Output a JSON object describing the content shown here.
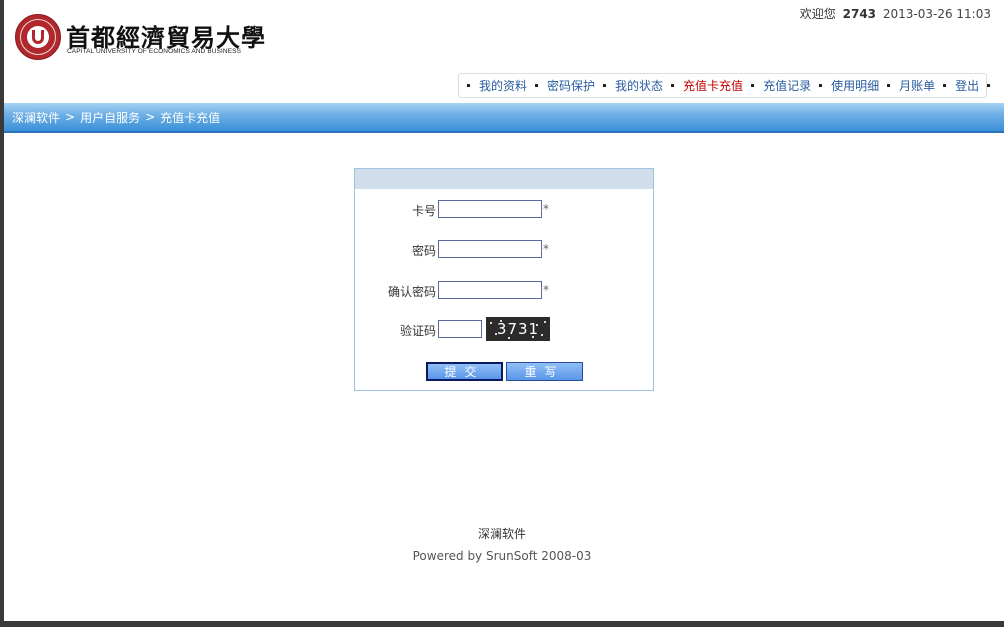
{
  "header": {
    "logo": {
      "cn_name": "首都經濟貿易大學",
      "en_name": "CAPITAL UNIVERSITY OF ECONOMICS AND BUSINESS"
    },
    "welcome": {
      "text": "欢迎您",
      "user_id": "2743",
      "datetime": "2013-03-26 11:03"
    }
  },
  "nav": {
    "items": [
      {
        "label": "我的资料"
      },
      {
        "label": "密码保护"
      },
      {
        "label": "我的状态"
      },
      {
        "label": "充值卡充值"
      },
      {
        "label": "充值记录"
      },
      {
        "label": "使用明细"
      },
      {
        "label": "月账单"
      },
      {
        "label": "登出"
      }
    ],
    "active_index": 3
  },
  "breadcrumb": {
    "items": [
      "深澜软件",
      "用户自服务",
      "充值卡充值"
    ],
    "separator": ">"
  },
  "form": {
    "fields": [
      {
        "label": "卡号",
        "value": "",
        "required_mark": "*"
      },
      {
        "label": "密码",
        "value": "",
        "required_mark": "*"
      },
      {
        "label": "确认密码",
        "value": "",
        "required_mark": "*"
      },
      {
        "label": "验证码",
        "value": ""
      }
    ],
    "captcha_text": "3731",
    "submit_label": "提交",
    "reset_label": "重写"
  },
  "footer": {
    "company": "深澜软件",
    "powered_by": "Powered by SrunSoft 2008-03"
  },
  "colors": {
    "nav_link": "#2a5d9f",
    "nav_active": "#c00000",
    "bar_blue": "#3a8fd8",
    "panel_head": "#d0deec"
  }
}
